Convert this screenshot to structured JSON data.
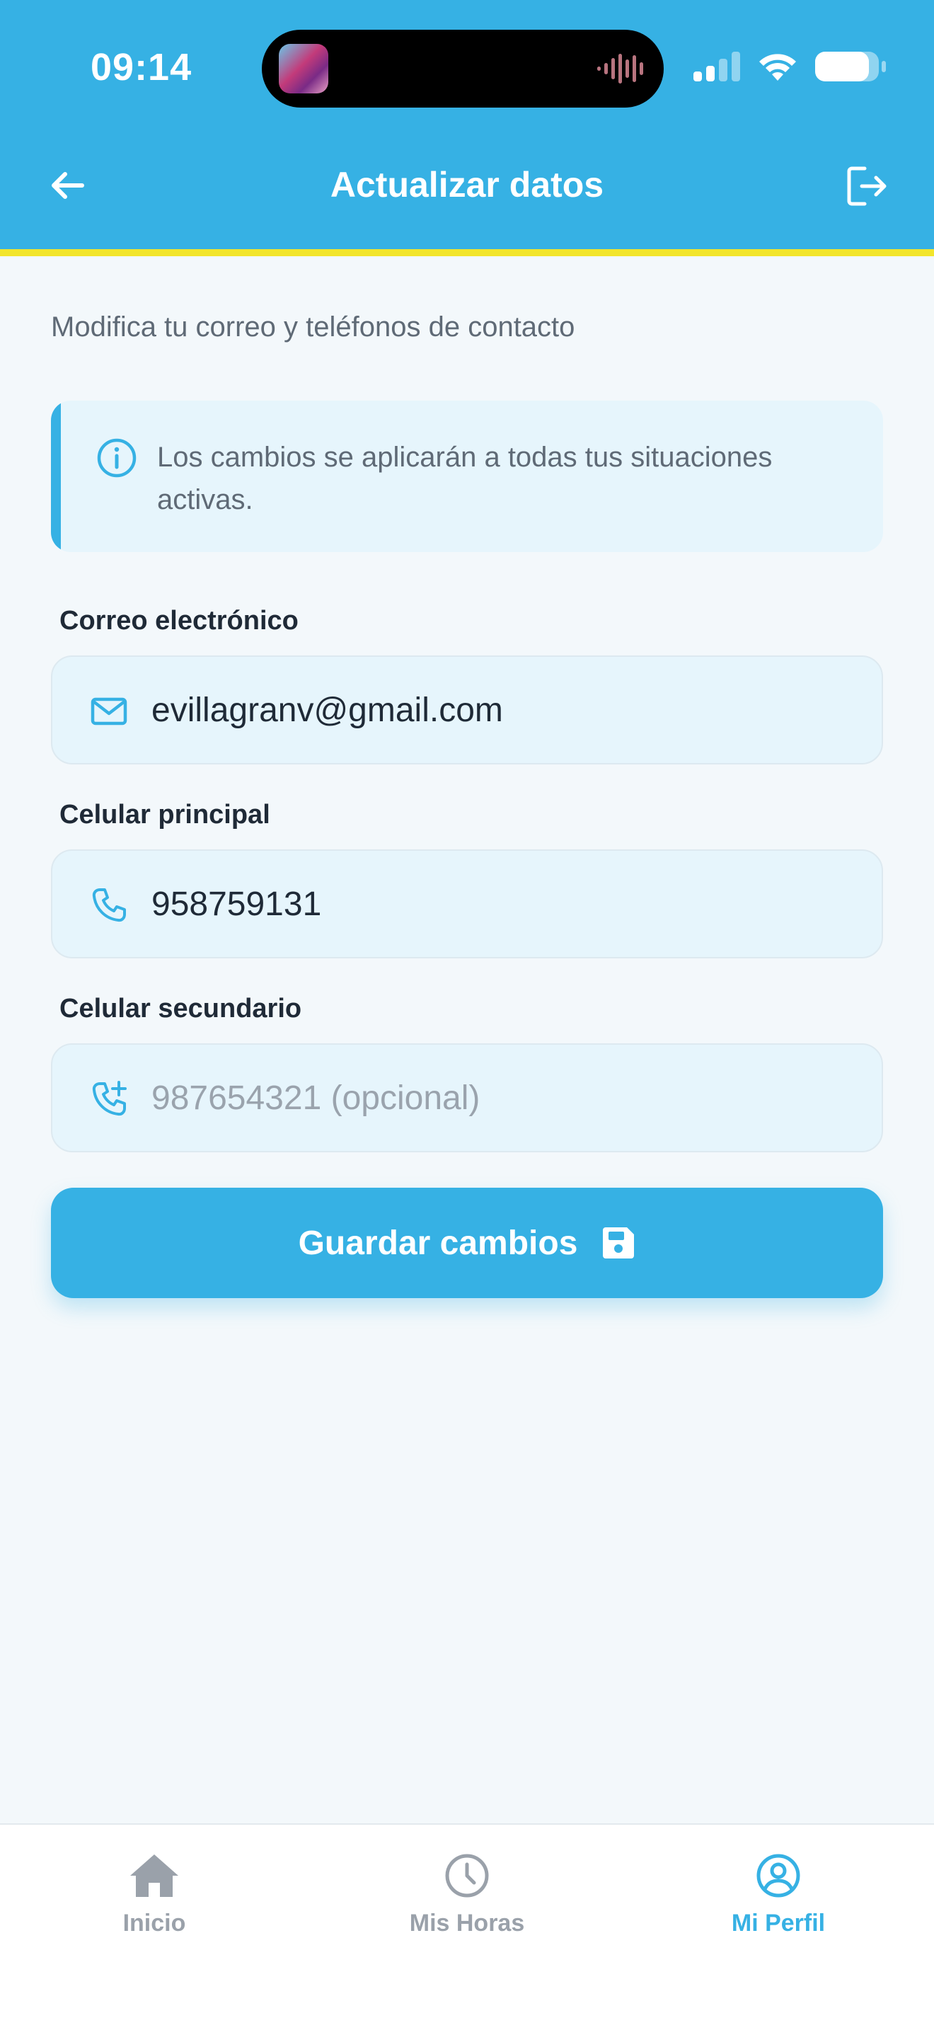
{
  "status_bar": {
    "time": "09:14"
  },
  "header": {
    "title": "Actualizar datos"
  },
  "subtitle": "Modifica tu correo y teléfonos de contacto",
  "info": {
    "text": "Los cambios se aplicarán a todas tus situaciones activas."
  },
  "form": {
    "email": {
      "label": "Correo electrónico",
      "value": "evillagranv@gmail.com",
      "placeholder": ""
    },
    "phone_primary": {
      "label": "Celular principal",
      "value": "958759131",
      "placeholder": ""
    },
    "phone_secondary": {
      "label": "Celular secundario",
      "value": "",
      "placeholder": "987654321 (opcional)"
    }
  },
  "save_button": {
    "label": "Guardar cambios"
  },
  "bottom_nav": {
    "items": [
      {
        "label": "Inicio",
        "icon": "home-icon",
        "active": false
      },
      {
        "label": "Mis Horas",
        "icon": "clock-icon",
        "active": false
      },
      {
        "label": "Mi Perfil",
        "icon": "user-circle-icon",
        "active": true
      }
    ]
  },
  "colors": {
    "primary": "#36b1e4",
    "accent_stripe": "#f2e52b",
    "field_bg": "#e6f5fc",
    "nav_inactive": "#9aa1aa",
    "nav_active": "#36b1e4"
  }
}
